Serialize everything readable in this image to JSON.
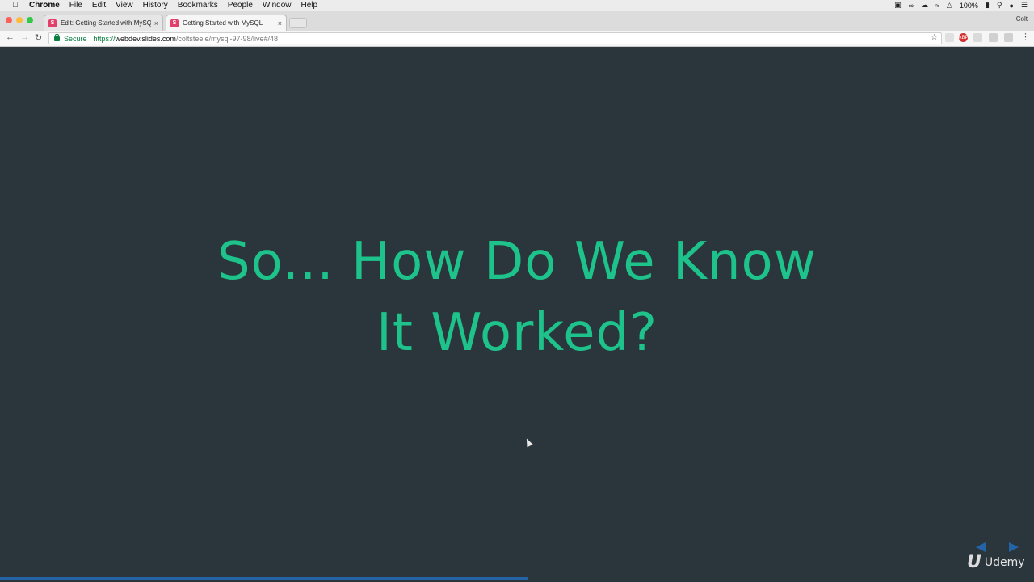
{
  "menubar": {
    "app_name": "Chrome",
    "items": [
      "File",
      "Edit",
      "View",
      "History",
      "Bookmarks",
      "People",
      "Window",
      "Help"
    ],
    "battery": "100%",
    "user": "Colt"
  },
  "tabs": [
    {
      "title": "Edit: Getting Started with MySQL",
      "favicon_letter": "S",
      "active": false
    },
    {
      "title": "Getting Started with MySQL",
      "favicon_letter": "S",
      "active": true
    }
  ],
  "toolbar": {
    "secure_label": "Secure",
    "url_scheme": "https://",
    "url_host": "webdev.slides.com",
    "url_path": "/coltsteele/mysql-97-98/live#/48"
  },
  "slide": {
    "title_line1": "So... How Do We Know",
    "title_line2": "It Worked?",
    "progress": 0.51
  },
  "watermark": {
    "brand": "Udemy"
  },
  "colors": {
    "slide_background": "#2a363b",
    "title_accent": "#1ec28b",
    "nav_accent": "#2463a6",
    "favicon": "#e2406a"
  }
}
